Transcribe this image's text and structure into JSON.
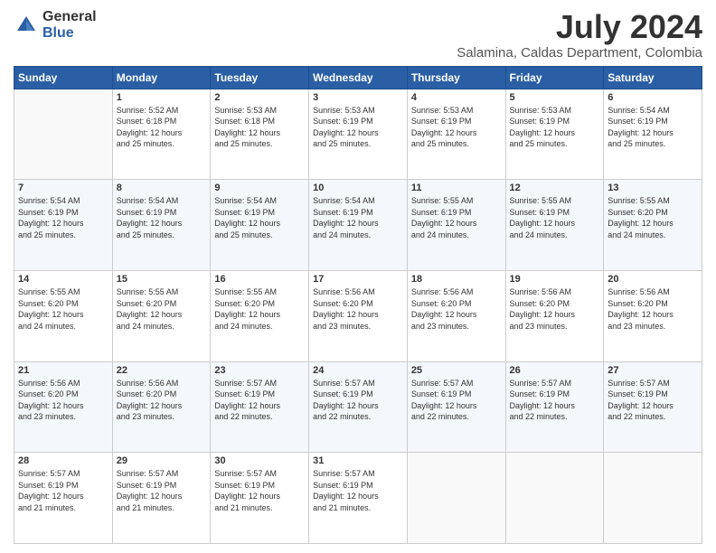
{
  "logo": {
    "general": "General",
    "blue": "Blue"
  },
  "title": "July 2024",
  "location": "Salamina, Caldas Department, Colombia",
  "weekdays": [
    "Sunday",
    "Monday",
    "Tuesday",
    "Wednesday",
    "Thursday",
    "Friday",
    "Saturday"
  ],
  "weeks": [
    [
      {
        "day": "",
        "info": ""
      },
      {
        "day": "1",
        "info": "Sunrise: 5:52 AM\nSunset: 6:18 PM\nDaylight: 12 hours\nand 25 minutes."
      },
      {
        "day": "2",
        "info": "Sunrise: 5:53 AM\nSunset: 6:18 PM\nDaylight: 12 hours\nand 25 minutes."
      },
      {
        "day": "3",
        "info": "Sunrise: 5:53 AM\nSunset: 6:19 PM\nDaylight: 12 hours\nand 25 minutes."
      },
      {
        "day": "4",
        "info": "Sunrise: 5:53 AM\nSunset: 6:19 PM\nDaylight: 12 hours\nand 25 minutes."
      },
      {
        "day": "5",
        "info": "Sunrise: 5:53 AM\nSunset: 6:19 PM\nDaylight: 12 hours\nand 25 minutes."
      },
      {
        "day": "6",
        "info": "Sunrise: 5:54 AM\nSunset: 6:19 PM\nDaylight: 12 hours\nand 25 minutes."
      }
    ],
    [
      {
        "day": "7",
        "info": "Sunrise: 5:54 AM\nSunset: 6:19 PM\nDaylight: 12 hours\nand 25 minutes."
      },
      {
        "day": "8",
        "info": "Sunrise: 5:54 AM\nSunset: 6:19 PM\nDaylight: 12 hours\nand 25 minutes."
      },
      {
        "day": "9",
        "info": "Sunrise: 5:54 AM\nSunset: 6:19 PM\nDaylight: 12 hours\nand 25 minutes."
      },
      {
        "day": "10",
        "info": "Sunrise: 5:54 AM\nSunset: 6:19 PM\nDaylight: 12 hours\nand 24 minutes."
      },
      {
        "day": "11",
        "info": "Sunrise: 5:55 AM\nSunset: 6:19 PM\nDaylight: 12 hours\nand 24 minutes."
      },
      {
        "day": "12",
        "info": "Sunrise: 5:55 AM\nSunset: 6:19 PM\nDaylight: 12 hours\nand 24 minutes."
      },
      {
        "day": "13",
        "info": "Sunrise: 5:55 AM\nSunset: 6:20 PM\nDaylight: 12 hours\nand 24 minutes."
      }
    ],
    [
      {
        "day": "14",
        "info": "Sunrise: 5:55 AM\nSunset: 6:20 PM\nDaylight: 12 hours\nand 24 minutes."
      },
      {
        "day": "15",
        "info": "Sunrise: 5:55 AM\nSunset: 6:20 PM\nDaylight: 12 hours\nand 24 minutes."
      },
      {
        "day": "16",
        "info": "Sunrise: 5:55 AM\nSunset: 6:20 PM\nDaylight: 12 hours\nand 24 minutes."
      },
      {
        "day": "17",
        "info": "Sunrise: 5:56 AM\nSunset: 6:20 PM\nDaylight: 12 hours\nand 23 minutes."
      },
      {
        "day": "18",
        "info": "Sunrise: 5:56 AM\nSunset: 6:20 PM\nDaylight: 12 hours\nand 23 minutes."
      },
      {
        "day": "19",
        "info": "Sunrise: 5:56 AM\nSunset: 6:20 PM\nDaylight: 12 hours\nand 23 minutes."
      },
      {
        "day": "20",
        "info": "Sunrise: 5:56 AM\nSunset: 6:20 PM\nDaylight: 12 hours\nand 23 minutes."
      }
    ],
    [
      {
        "day": "21",
        "info": "Sunrise: 5:56 AM\nSunset: 6:20 PM\nDaylight: 12 hours\nand 23 minutes."
      },
      {
        "day": "22",
        "info": "Sunrise: 5:56 AM\nSunset: 6:20 PM\nDaylight: 12 hours\nand 23 minutes."
      },
      {
        "day": "23",
        "info": "Sunrise: 5:57 AM\nSunset: 6:19 PM\nDaylight: 12 hours\nand 22 minutes."
      },
      {
        "day": "24",
        "info": "Sunrise: 5:57 AM\nSunset: 6:19 PM\nDaylight: 12 hours\nand 22 minutes."
      },
      {
        "day": "25",
        "info": "Sunrise: 5:57 AM\nSunset: 6:19 PM\nDaylight: 12 hours\nand 22 minutes."
      },
      {
        "day": "26",
        "info": "Sunrise: 5:57 AM\nSunset: 6:19 PM\nDaylight: 12 hours\nand 22 minutes."
      },
      {
        "day": "27",
        "info": "Sunrise: 5:57 AM\nSunset: 6:19 PM\nDaylight: 12 hours\nand 22 minutes."
      }
    ],
    [
      {
        "day": "28",
        "info": "Sunrise: 5:57 AM\nSunset: 6:19 PM\nDaylight: 12 hours\nand 21 minutes."
      },
      {
        "day": "29",
        "info": "Sunrise: 5:57 AM\nSunset: 6:19 PM\nDaylight: 12 hours\nand 21 minutes."
      },
      {
        "day": "30",
        "info": "Sunrise: 5:57 AM\nSunset: 6:19 PM\nDaylight: 12 hours\nand 21 minutes."
      },
      {
        "day": "31",
        "info": "Sunrise: 5:57 AM\nSunset: 6:19 PM\nDaylight: 12 hours\nand 21 minutes."
      },
      {
        "day": "",
        "info": ""
      },
      {
        "day": "",
        "info": ""
      },
      {
        "day": "",
        "info": ""
      }
    ]
  ]
}
